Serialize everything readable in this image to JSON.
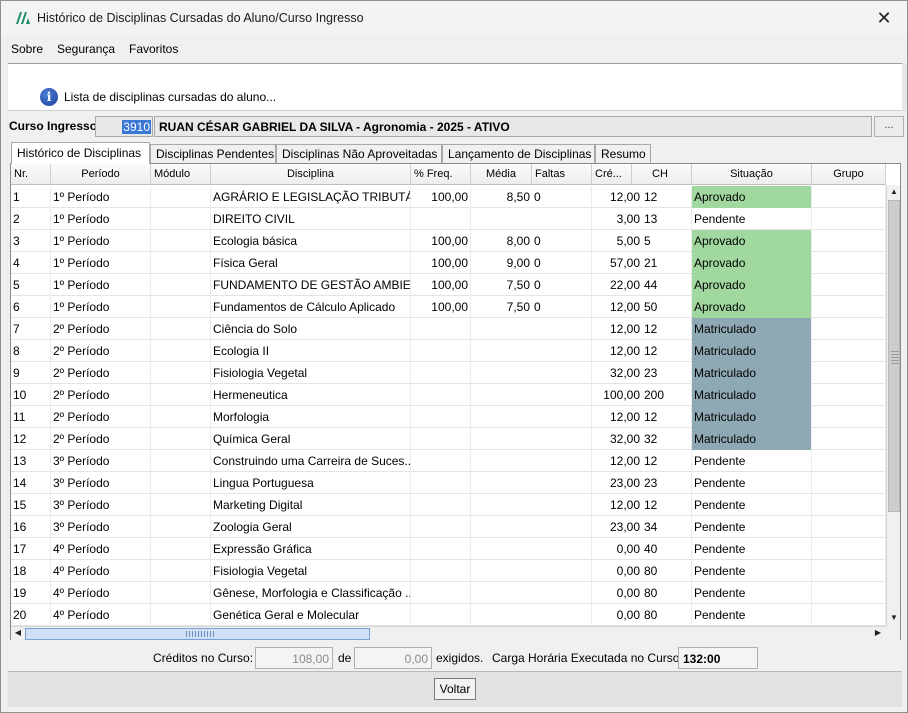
{
  "window": {
    "title": "Histórico de Disciplinas Cursadas do Aluno/Curso Ingresso",
    "close_glyph": "✕"
  },
  "menu": [
    {
      "label": "Sobre"
    },
    {
      "label": "Segurança"
    },
    {
      "label": "Favoritos"
    }
  ],
  "info": {
    "icon": "info-icon",
    "text": "Lista de disciplinas cursadas do aluno..."
  },
  "curso": {
    "label": "Curso Ingresso:",
    "code": "3910",
    "name": "RUAN CÉSAR GABRIEL DA SILVA - Agronomia - 2025 - ATIVO",
    "button": "..."
  },
  "tabs": [
    {
      "label": "Histórico de Disciplinas",
      "active": true
    },
    {
      "label": "Disciplinas Pendentes"
    },
    {
      "label": "Disciplinas Não Aproveitadas"
    },
    {
      "label": "Lançamento de Disciplinas"
    },
    {
      "label": "Resumo"
    }
  ],
  "columns": [
    "Nr.",
    "Período",
    "Módulo",
    "Disciplina",
    "% Freq.",
    "Média",
    "Faltas",
    "Cré...",
    "CH",
    "Situação",
    "Grupo"
  ],
  "rows": [
    {
      "nr": "1",
      "periodo": "1º Período",
      "modulo": "",
      "disciplina": "AGRÁRIO E LEGISLAÇÃO TRIBUTÁRIA",
      "freq": "100,00",
      "media": "8,50",
      "faltas": "0",
      "creditos": "12,00",
      "ch": "12",
      "situacao": "Aprovado"
    },
    {
      "nr": "2",
      "periodo": "1º Período",
      "modulo": "",
      "disciplina": "DIREITO CIVIL",
      "freq": "",
      "media": "",
      "faltas": "",
      "creditos": "3,00",
      "ch": "13",
      "situacao": "Pendente"
    },
    {
      "nr": "3",
      "periodo": "1º Período",
      "modulo": "",
      "disciplina": "Ecologia básica",
      "freq": "100,00",
      "media": "8,00",
      "faltas": "0",
      "creditos": "5,00",
      "ch": "5",
      "situacao": "Aprovado"
    },
    {
      "nr": "4",
      "periodo": "1º Período",
      "modulo": "",
      "disciplina": "Física Geral",
      "freq": "100,00",
      "media": "9,00",
      "faltas": "0",
      "creditos": "57,00",
      "ch": "21",
      "situacao": "Aprovado"
    },
    {
      "nr": "5",
      "periodo": "1º Período",
      "modulo": "",
      "disciplina": "FUNDAMENTO DE GESTÃO AMBIE...",
      "freq": "100,00",
      "media": "7,50",
      "faltas": "0",
      "creditos": "22,00",
      "ch": "44",
      "situacao": "Aprovado"
    },
    {
      "nr": "6",
      "periodo": "1º Período",
      "modulo": "",
      "disciplina": "Fundamentos de Cálculo Aplicado",
      "freq": "100,00",
      "media": "7,50",
      "faltas": "0",
      "creditos": "12,00",
      "ch": "50",
      "situacao": "Aprovado"
    },
    {
      "nr": "7",
      "periodo": "2º Período",
      "modulo": "",
      "disciplina": "Ciência do Solo",
      "freq": "",
      "media": "",
      "faltas": "",
      "creditos": "12,00",
      "ch": "12",
      "situacao": "Matriculado"
    },
    {
      "nr": "8",
      "periodo": "2º Período",
      "modulo": "",
      "disciplina": "Ecologia II",
      "freq": "",
      "media": "",
      "faltas": "",
      "creditos": "12,00",
      "ch": "12",
      "situacao": "Matriculado"
    },
    {
      "nr": "9",
      "periodo": "2º Período",
      "modulo": "",
      "disciplina": "Fisiologia Vegetal",
      "freq": "",
      "media": "",
      "faltas": "",
      "creditos": "32,00",
      "ch": "23",
      "situacao": "Matriculado"
    },
    {
      "nr": "10",
      "periodo": "2º Período",
      "modulo": "",
      "disciplina": "Hermeneutica",
      "freq": "",
      "media": "",
      "faltas": "",
      "creditos": "100,00",
      "ch": "200",
      "situacao": "Matriculado"
    },
    {
      "nr": "11",
      "periodo": "2º Período",
      "modulo": "",
      "disciplina": "Morfologia",
      "freq": "",
      "media": "",
      "faltas": "",
      "creditos": "12,00",
      "ch": "12",
      "situacao": "Matriculado"
    },
    {
      "nr": "12",
      "periodo": "2º Período",
      "modulo": "",
      "disciplina": "Química Geral",
      "freq": "",
      "media": "",
      "faltas": "",
      "creditos": "32,00",
      "ch": "32",
      "situacao": "Matriculado"
    },
    {
      "nr": "13",
      "periodo": "3º Período",
      "modulo": "",
      "disciplina": "Construindo uma Carreira de Suces...",
      "freq": "",
      "media": "",
      "faltas": "",
      "creditos": "12,00",
      "ch": "12",
      "situacao": "Pendente"
    },
    {
      "nr": "14",
      "periodo": "3º Período",
      "modulo": "",
      "disciplina": "Lingua Portuguesa",
      "freq": "",
      "media": "",
      "faltas": "",
      "creditos": "23,00",
      "ch": "23",
      "situacao": "Pendente"
    },
    {
      "nr": "15",
      "periodo": "3º Período",
      "modulo": "",
      "disciplina": "Marketing Digital",
      "freq": "",
      "media": "",
      "faltas": "",
      "creditos": "12,00",
      "ch": "12",
      "situacao": "Pendente"
    },
    {
      "nr": "16",
      "periodo": "3º Período",
      "modulo": "",
      "disciplina": "Zoologia Geral",
      "freq": "",
      "media": "",
      "faltas": "",
      "creditos": "23,00",
      "ch": "34",
      "situacao": "Pendente"
    },
    {
      "nr": "17",
      "periodo": "4º Período",
      "modulo": "",
      "disciplina": "Expressão Gráfica",
      "freq": "",
      "media": "",
      "faltas": "",
      "creditos": "0,00",
      "ch": "40",
      "situacao": "Pendente"
    },
    {
      "nr": "18",
      "periodo": "4º Período",
      "modulo": "",
      "disciplina": "Fisiologia Vegetal",
      "freq": "",
      "media": "",
      "faltas": "",
      "creditos": "0,00",
      "ch": "80",
      "situacao": "Pendente"
    },
    {
      "nr": "19",
      "periodo": "4º Período",
      "modulo": "",
      "disciplina": "Gênese, Morfologia e Classificação ...",
      "freq": "",
      "media": "",
      "faltas": "",
      "creditos": "0,00",
      "ch": "80",
      "situacao": "Pendente"
    },
    {
      "nr": "20",
      "periodo": "4º Período",
      "modulo": "",
      "disciplina": "Genética Geral e Molecular",
      "freq": "",
      "media": "",
      "faltas": "",
      "creditos": "0,00",
      "ch": "80",
      "situacao": "Pendente"
    }
  ],
  "status_colors": {
    "Aprovado": "#a0d8a0",
    "Matriculado": "#8fa9b4",
    "Pendente": "#ffffff"
  },
  "footer": {
    "creditos_label": "Créditos no Curso:",
    "creditos_value": "108,00",
    "de_label": "de",
    "exigidos_value": "0,00",
    "exigidos_label": "exigidos.",
    "carga_label": "Carga Horária Executada no Curso:",
    "carga_value": "132:00"
  },
  "buttons": {
    "voltar": "Voltar"
  }
}
